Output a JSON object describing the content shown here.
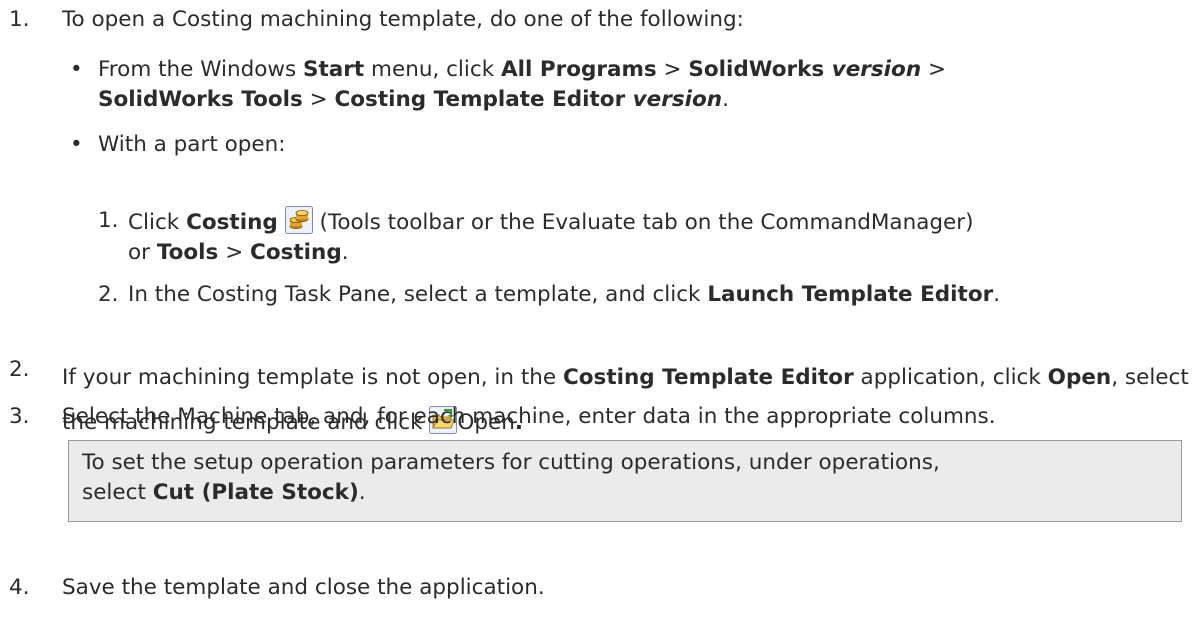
{
  "steps": [
    {
      "number": "1.",
      "text": "To open a Costing machining template, do one of the following:"
    },
    {
      "number": "2.",
      "text_parts": [
        "If your machining template is not open, in the ",
        "Costing Template Editor",
        " application, click ",
        "Open",
        ", select the machining template and click ",
        "Open",
        "."
      ]
    },
    {
      "number": "3.",
      "text": "Select the Machine tab, and, for each machine, enter data in the appropriate columns."
    },
    {
      "number": "4.",
      "text": "Save the template and close the application."
    }
  ],
  "bullets": [
    {
      "symbol": "•",
      "parts": [
        "From the Windows ",
        "Start",
        " menu, click ",
        "All Programs",
        " > ",
        "SolidWorks ",
        "version",
        " >",
        "SolidWorks Tools",
        " > ",
        "Costing Template Editor ",
        "version",
        "."
      ]
    },
    {
      "symbol": "•",
      "text": "With a part open:"
    }
  ],
  "substeps": [
    {
      "number": "1.",
      "parts": [
        "Click ",
        "Costing",
        " (Tools toolbar or the Evaluate tab on the CommandManager)",
        "or ",
        "Tools",
        " > ",
        "Costing",
        "."
      ]
    },
    {
      "number": "2.",
      "parts": [
        "In the Costing Task Pane, select a template, and click ",
        "Launch Template Editor",
        "."
      ]
    }
  ],
  "note": {
    "parts": [
      "To set the setup operation parameters for cutting operations, under operations,",
      "select ",
      "Cut (Plate Stock)",
      "."
    ]
  },
  "icons": {
    "costing": "costing-coins-icon",
    "open": "open-folder-icon"
  }
}
